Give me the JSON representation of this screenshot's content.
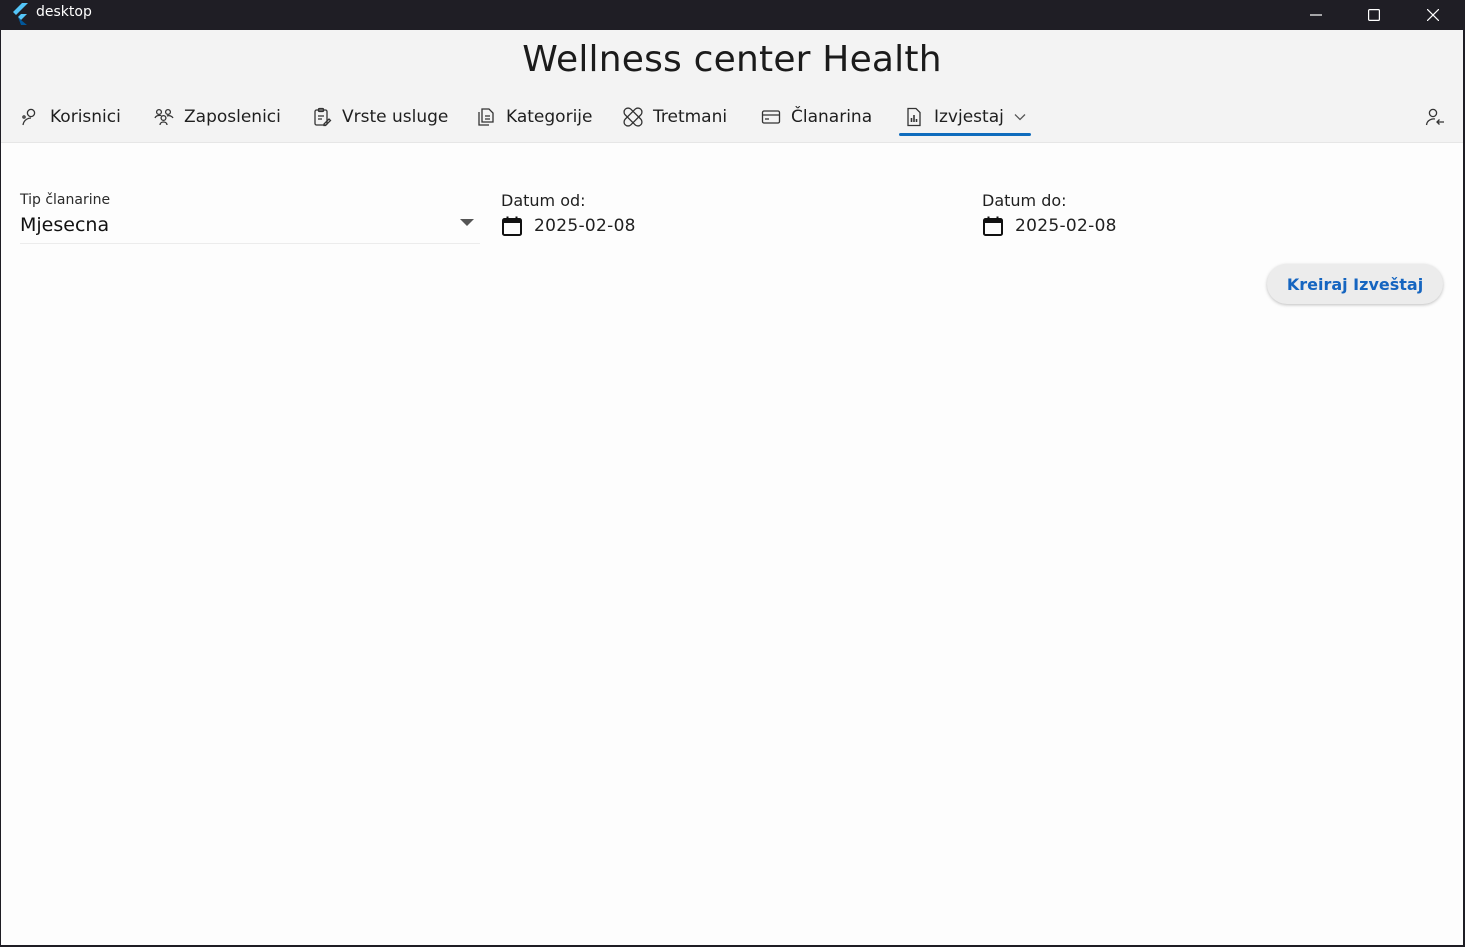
{
  "window": {
    "title": "desktop"
  },
  "header": {
    "title": "Wellness center Health"
  },
  "nav": {
    "items": [
      {
        "label": "Korisnici",
        "icon": "person-icon"
      },
      {
        "label": "Zaposlenici",
        "icon": "people-group-icon"
      },
      {
        "label": "Vrste usluge",
        "icon": "clipboard-edit-icon"
      },
      {
        "label": "Kategorije",
        "icon": "document-copy-icon"
      },
      {
        "label": "Tretmani",
        "icon": "bandage-icon"
      },
      {
        "label": "Članarina",
        "icon": "card-icon"
      },
      {
        "label": "Izvjestaj",
        "icon": "report-icon",
        "active": true,
        "has_dropdown": true
      }
    ],
    "account_icon": "person-arrow-icon"
  },
  "form": {
    "membership_type_label": "Tip članarine",
    "membership_type_value": "Mjesecna",
    "date_from_label": "Datum od:",
    "date_from_value": "2025-02-08",
    "date_to_label": "Datum do:",
    "date_to_value": "2025-02-08",
    "create_button_label": "Kreiraj Izveštaj"
  },
  "colors": {
    "accent": "#0f6cbd",
    "button_text": "#1565c0",
    "titlebar": "#1f1e25",
    "header_bg": "#f3f3f3",
    "content_bg": "#fdfdfd"
  }
}
